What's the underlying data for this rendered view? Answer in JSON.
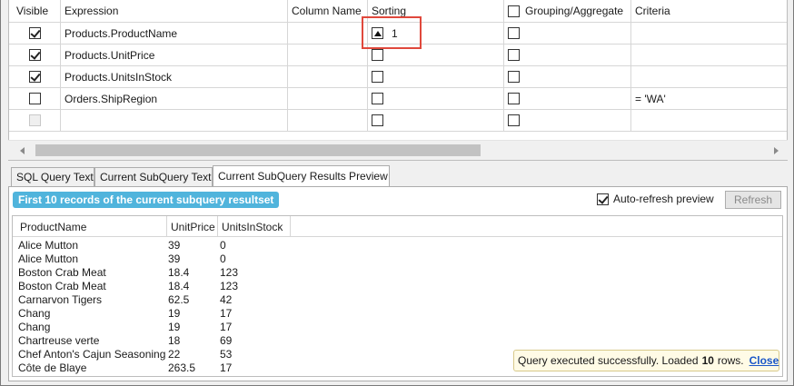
{
  "grid": {
    "headers": {
      "visible": "Visible",
      "expression": "Expression",
      "column_name": "Column Name",
      "sorting": "Sorting",
      "grouping": "Grouping/Aggregate",
      "criteria": "Criteria"
    },
    "rows": [
      {
        "visible": true,
        "expression": "Products.ProductName",
        "column_name": "",
        "sort_dir": "asc",
        "sort_order": "1",
        "grouping": false,
        "criteria": ""
      },
      {
        "visible": true,
        "expression": "Products.UnitPrice",
        "column_name": "",
        "sort_dir": "",
        "sort_order": "",
        "grouping": false,
        "criteria": ""
      },
      {
        "visible": true,
        "expression": "Products.UnitsInStock",
        "column_name": "",
        "sort_dir": "",
        "sort_order": "",
        "grouping": false,
        "criteria": ""
      },
      {
        "visible": false,
        "expression": "Orders.ShipRegion",
        "column_name": "",
        "sort_dir": "",
        "sort_order": "",
        "grouping": false,
        "criteria": "= 'WA'"
      },
      {
        "visible": false,
        "expression": "",
        "column_name": "",
        "sort_dir": "",
        "sort_order": "",
        "grouping": false,
        "criteria": ""
      }
    ]
  },
  "tabs": [
    {
      "label": "SQL Query Text",
      "active": false
    },
    {
      "label": "Current SubQuery Text",
      "active": false
    },
    {
      "label": "Current SubQuery Results Preview",
      "active": true
    }
  ],
  "preview": {
    "badge": "First 10 records of the current subquery resultset",
    "auto_refresh_label": "Auto-refresh preview",
    "auto_refresh_checked": true,
    "refresh_label": "Refresh",
    "columns": [
      "ProductName",
      "UnitPrice",
      "UnitsInStock"
    ],
    "rows": [
      [
        "Alice Mutton",
        "39",
        "0"
      ],
      [
        "Alice Mutton",
        "39",
        "0"
      ],
      [
        "Boston Crab Meat",
        "18.4",
        "123"
      ],
      [
        "Boston Crab Meat",
        "18.4",
        "123"
      ],
      [
        "Carnarvon Tigers",
        "62.5",
        "42"
      ],
      [
        "Chang",
        "19",
        "17"
      ],
      [
        "Chang",
        "19",
        "17"
      ],
      [
        "Chartreuse verte",
        "18",
        "69"
      ],
      [
        "Chef Anton's Cajun Seasoning",
        "22",
        "53"
      ],
      [
        "Côte de Blaye",
        "263.5",
        "17"
      ]
    ]
  },
  "toast": {
    "prefix": "Query executed successfully. Loaded",
    "count": "10",
    "suffix": "rows.",
    "close_label": "Close"
  },
  "colors": {
    "badge": "#50b4dc",
    "highlight": "#e0483c",
    "link": "#1a56c8"
  }
}
